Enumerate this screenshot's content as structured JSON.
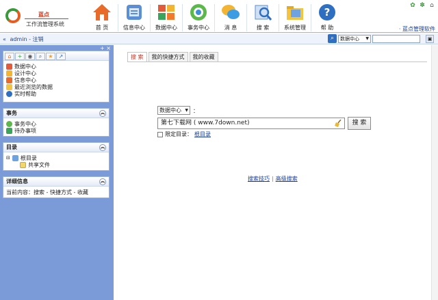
{
  "brand": {
    "name": "蓝点",
    "subtitle": "工作流管理系统",
    "link": "· 蓝点管理软件"
  },
  "nav": [
    {
      "label": "首 页",
      "icon": "home-icon"
    },
    {
      "label": "信息中心",
      "icon": "info-center-icon"
    },
    {
      "label": "数据中心",
      "icon": "data-center-icon"
    },
    {
      "label": "事务中心",
      "icon": "affairs-center-icon"
    },
    {
      "label": "消 息",
      "icon": "message-icon"
    },
    {
      "label": "搜 索",
      "icon": "search-icon"
    },
    {
      "label": "系统管理",
      "icon": "system-admin-icon"
    },
    {
      "label": "帮 助",
      "icon": "help-icon"
    }
  ],
  "user": {
    "name": "admin",
    "separator": " - ",
    "logout": "注销"
  },
  "topsearch": {
    "scope": "数据中心"
  },
  "sidebar": {
    "quick": [
      "数据中心",
      "设计中心",
      "信息中心",
      "最近浏览的数据",
      "实时帮助"
    ],
    "affairs": {
      "title": "事务",
      "items": [
        "事务中心",
        "待办事项"
      ]
    },
    "catalog": {
      "title": "目录",
      "root": "根目录",
      "child": "共享文件"
    },
    "detail": {
      "title": "详细信息",
      "text": "当前内容：搜索 - 快捷方式 - 收藏"
    }
  },
  "main": {
    "tabs": [
      "搜 索",
      "我的快捷方式",
      "我的收藏"
    ],
    "scope": "数据中心",
    "colon": "：",
    "query": "第七下载网 ( www.7down.net)",
    "search_button": "搜 索",
    "limit_label": "限定目录：",
    "limit_link": "根目录",
    "tips": "搜索技巧",
    "sep": "|",
    "advanced": "高级搜索"
  },
  "colors": {
    "sidebar": "#7b9ad8",
    "link": "#1a3e9a",
    "active_tab": "#c0392b"
  }
}
